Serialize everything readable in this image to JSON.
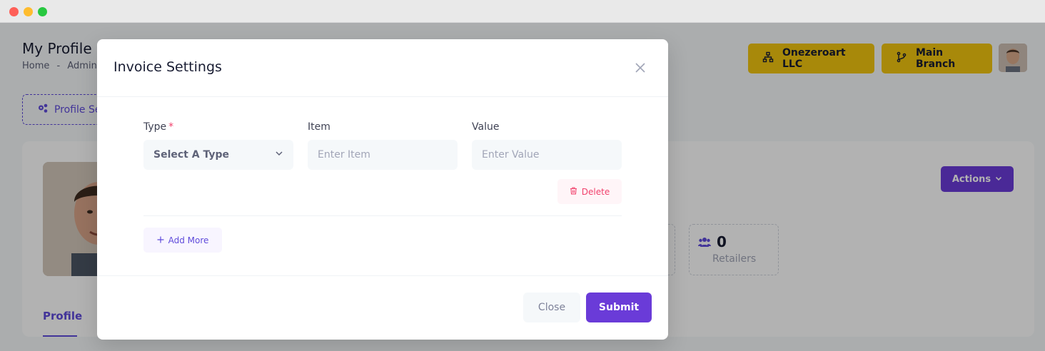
{
  "colors": {
    "accent": "#6a3bd8",
    "brand_yellow": "#f1c40f",
    "danger": "#f1416c",
    "primary_text": "#181c32",
    "muted_text": "#a1a5b7"
  },
  "header": {
    "page_title": "My Profile",
    "breadcrumb": [
      "Home",
      "-",
      "Admin"
    ],
    "org_button": {
      "label": "Onezeroart LLC",
      "icon": "sitemap-icon"
    },
    "branch_button": {
      "label": "Main Branch",
      "icon": "git-branch-icon"
    }
  },
  "subnav": {
    "profile_settings_label": "Profile Se"
  },
  "card": {
    "actions_label": "Actions",
    "stats": [
      {
        "value": "0",
        "label": "Retailers",
        "icon": "users-icon"
      }
    ],
    "tabs": [
      {
        "label": "Profile",
        "active": true
      }
    ]
  },
  "modal": {
    "title": "Invoice Settings",
    "fields": {
      "type": {
        "label": "Type",
        "required_mark": "*",
        "selected": "Select A Type"
      },
      "item": {
        "label": "Item",
        "placeholder": "Enter Item",
        "value": ""
      },
      "value": {
        "label": "Value",
        "placeholder": "Enter Value",
        "value": ""
      }
    },
    "delete_label": "Delete",
    "add_more_label": "Add More",
    "footer": {
      "close_label": "Close",
      "submit_label": "Submit"
    }
  }
}
